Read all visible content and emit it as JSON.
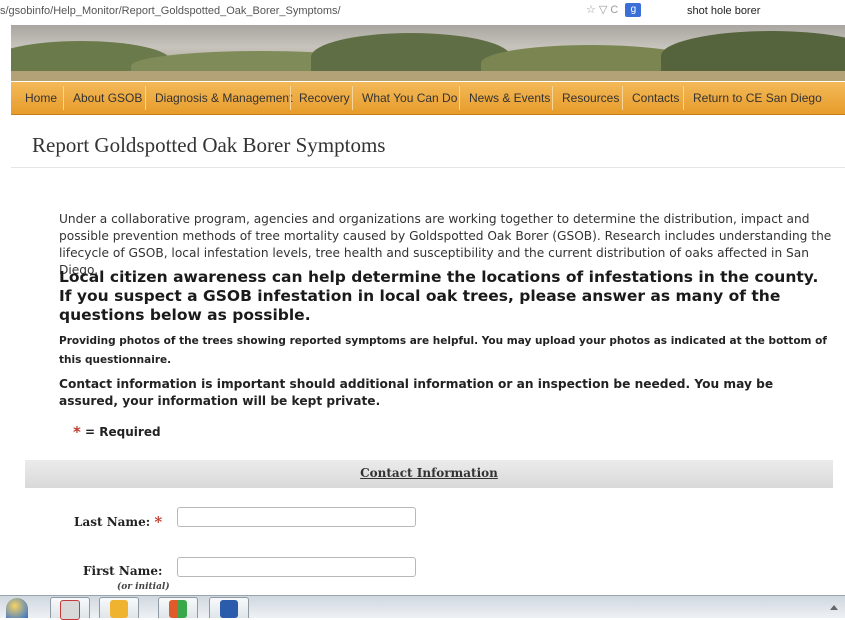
{
  "browser": {
    "url": "s/gsobinfo/Help_Monitor/Report_Goldspotted_Oak_Borer_Symptoms/",
    "url_tools": "☆ ▽ C",
    "search_engine_glyph": "g",
    "search_query": "shot hole borer"
  },
  "nav": {
    "items": [
      {
        "label": "Home"
      },
      {
        "label": "About GSOB"
      },
      {
        "label": "Diagnosis & Management"
      },
      {
        "label": "Recovery"
      },
      {
        "label": "What You Can Do"
      },
      {
        "label": "News & Events"
      },
      {
        "label": "Resources"
      },
      {
        "label": "Contacts"
      },
      {
        "label": "Return to CE San Diego"
      }
    ]
  },
  "page": {
    "title": "Report Goldspotted Oak Borer Symptoms",
    "intro": "Under a collaborative program, agencies and organizations are working together to determine the distribution, impact and possible prevention methods of tree mortality caused by Goldspotted Oak Borer (GSOB). Research includes understanding the lifecycle of GSOB, local infestation levels, tree health and susceptibility and the current distribution of oaks affected in San Diego.",
    "call_to_action": "Local citizen awareness can help determine the locations of infestations in the county. If you suspect a GSOB infestation in local oak trees, please answer as many of the questions below as possible.",
    "photos_note": "Providing photos of the trees showing reported symptoms are helpful. You may upload your photos as indicated at the bottom of this questionnaire.",
    "contact_note": "Contact information is important should additional information or an inspection be needed. You may be assured, your information will be kept private.",
    "required_star": "*",
    "required_text": "= Required"
  },
  "form": {
    "section_title": "Contact Information",
    "last_name_label": "Last Name:",
    "last_name_value": "",
    "first_name_label": "First Name:",
    "first_name_note": "(or initial)",
    "first_name_value": "",
    "required_marker": "*"
  },
  "taskbar": {
    "items": [
      {
        "icon": "internet-explorer-icon",
        "color": "#2f6fd1"
      },
      {
        "icon": "tools-icon",
        "color": "#c43a3a"
      },
      {
        "icon": "mail-icon",
        "color": "#f0b32f"
      },
      {
        "icon": "windows-icon",
        "color": "#e05a2a"
      },
      {
        "icon": "word-icon",
        "color": "#2a5cab"
      }
    ]
  },
  "colors": {
    "nav_bar": "#e79c2b",
    "required_star": "#c0392b",
    "section_header": "#d9d9d9"
  }
}
